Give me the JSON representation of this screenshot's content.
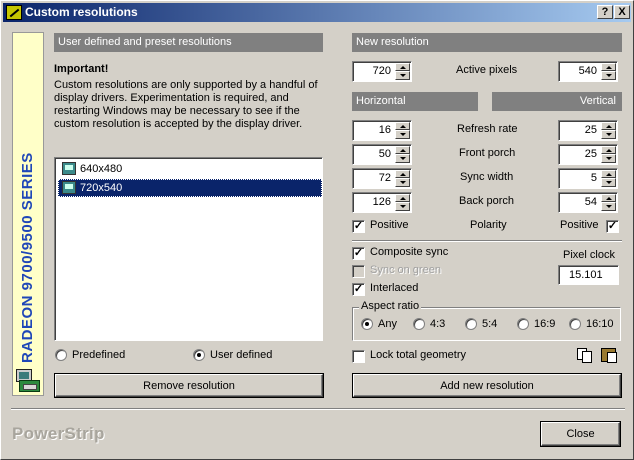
{
  "window": {
    "title": "Custom resolutions",
    "help_label": "?",
    "close_label": "X"
  },
  "sidebar": {
    "text": "RADEON 9700/9500 SERIES"
  },
  "left": {
    "header": "User defined and preset resolutions",
    "important_title": "Important!",
    "important_text": "Custom resolutions are only supported by a handful of display drivers. Experimentation is required, and restarting Windows may be necessary to see if the custom resolution is accepted by the display driver.",
    "resolutions": [
      {
        "label": "640x480",
        "selected": false
      },
      {
        "label": "720x540",
        "selected": true
      }
    ],
    "radio_predefined": "Predefined",
    "radio_user_defined": "User defined",
    "selected_radio": "User defined",
    "remove_button": "Remove resolution"
  },
  "right": {
    "header": "New resolution",
    "active_pixels_label": "Active pixels",
    "active_h": "720",
    "active_v": "540",
    "horizontal_header": "Horizontal",
    "vertical_header": "Vertical",
    "rows": [
      {
        "label": "Refresh rate",
        "h": "16",
        "v": "25"
      },
      {
        "label": "Front porch",
        "h": "50",
        "v": "25"
      },
      {
        "label": "Sync width",
        "h": "72",
        "v": "5"
      },
      {
        "label": "Back porch",
        "h": "126",
        "v": "54"
      }
    ],
    "polarity_label": "Polarity",
    "positive_h_label": "Positive",
    "positive_v_label": "Positive",
    "positive_h_checked": true,
    "positive_v_checked": true,
    "composite_sync_label": "Composite sync",
    "composite_sync_checked": true,
    "sync_on_green_label": "Sync on green",
    "sync_on_green_enabled": false,
    "interlaced_label": "Interlaced",
    "interlaced_checked": true,
    "pixel_clock_label": "Pixel clock",
    "pixel_clock_value": "15.101",
    "aspect_ratio_label": "Aspect ratio",
    "aspect_options": [
      "Any",
      "4:3",
      "5:4",
      "16:9",
      "16:10"
    ],
    "aspect_selected": "Any",
    "lock_geometry_label": "Lock total geometry",
    "lock_geometry_checked": false,
    "add_button": "Add new resolution"
  },
  "footer": {
    "brand": "PowerStrip",
    "close_button": "Close"
  },
  "colors": {
    "face": "#d4d0c8",
    "title_start": "#0a246a",
    "title_end": "#a6caf0",
    "sidebar_bg": "#ffffc8",
    "sidebar_text": "#1f47b8",
    "header_bg": "#808080",
    "selection": "#0a246a"
  },
  "icons": [
    "app-icon",
    "help-icon",
    "close-icon",
    "monitor-icon",
    "graphics-card-icon",
    "copy-icon",
    "paste-icon"
  ]
}
